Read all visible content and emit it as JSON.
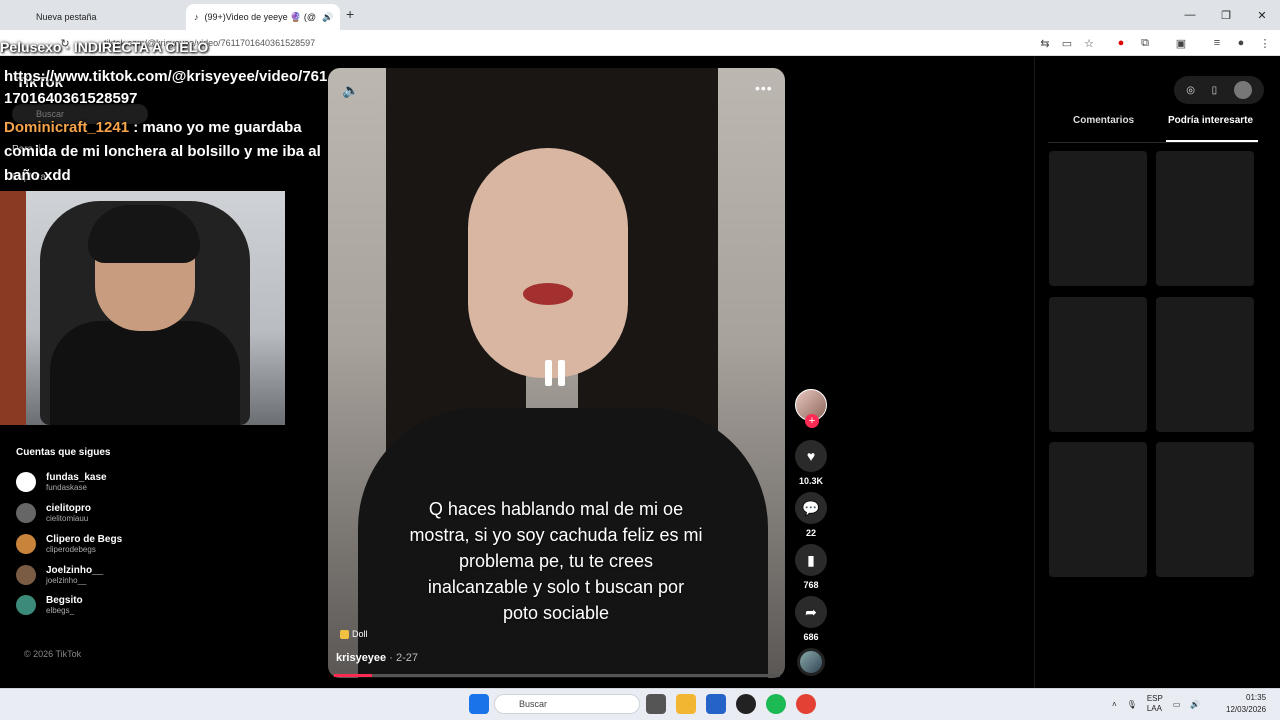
{
  "browser": {
    "tabs": [
      {
        "label": "Nueva pestaña"
      },
      {
        "label": "(99+)Video de yeeye 🔮 (@"
      }
    ],
    "url": "tiktok.com/@krisyeyee/video/7611701640361528597",
    "new_tab_symbol": "+"
  },
  "overlay": {
    "stream_title": "Pelusexo · INDIRECTA A CIELO",
    "video_url": "https://www.tiktok.com/@krisyeyee/video/7611701640361528597",
    "chat_user": "Dominicraft_1241",
    "chat_message": ": mano yo me guardaba comida de mi lonchera al bolsillo y me iba al baño xdd"
  },
  "tiktok": {
    "brand": "TikTok",
    "search_placeholder": "Buscar",
    "nav": [
      "Para ti",
      "Explorar"
    ],
    "following_header": "Cuentas que sigues",
    "following": [
      {
        "name": "fundas_kase",
        "handle": "fundaskase"
      },
      {
        "name": "cielitopro",
        "handle": "cielitomiauu"
      },
      {
        "name": "Clipero de Begs",
        "handle": "cliperodebegs"
      },
      {
        "name": "Joelzinho__",
        "handle": "joelzinho__"
      },
      {
        "name": "Begsito",
        "handle": "elbegs_"
      }
    ],
    "copyright": "© 2026 TikTok"
  },
  "video": {
    "caption": "Q haces hablando mal de mi oe mostra, si yo soy cachuda feliz es mi problema pe, tu te crees inalcanzable y solo t buscan por poto sociable",
    "music": "Doll",
    "author": "krisyeyee",
    "date": "· 2-27",
    "progress": 0.085,
    "likes": "10.3K",
    "comments": "22",
    "saves": "768",
    "shares": "686",
    "follow_symbol": "+"
  },
  "right_panel": {
    "tab_comments": "Comentarios",
    "tab_interest": "Podría interesarte"
  },
  "taskbar": {
    "search_placeholder": "Buscar",
    "lang_top": "ESP",
    "lang_bottom": "LAA",
    "time": "01:35",
    "date": "12/03/2026"
  },
  "colors": {
    "accent": "#fe2c55",
    "chat_user": "#f7a44a"
  }
}
